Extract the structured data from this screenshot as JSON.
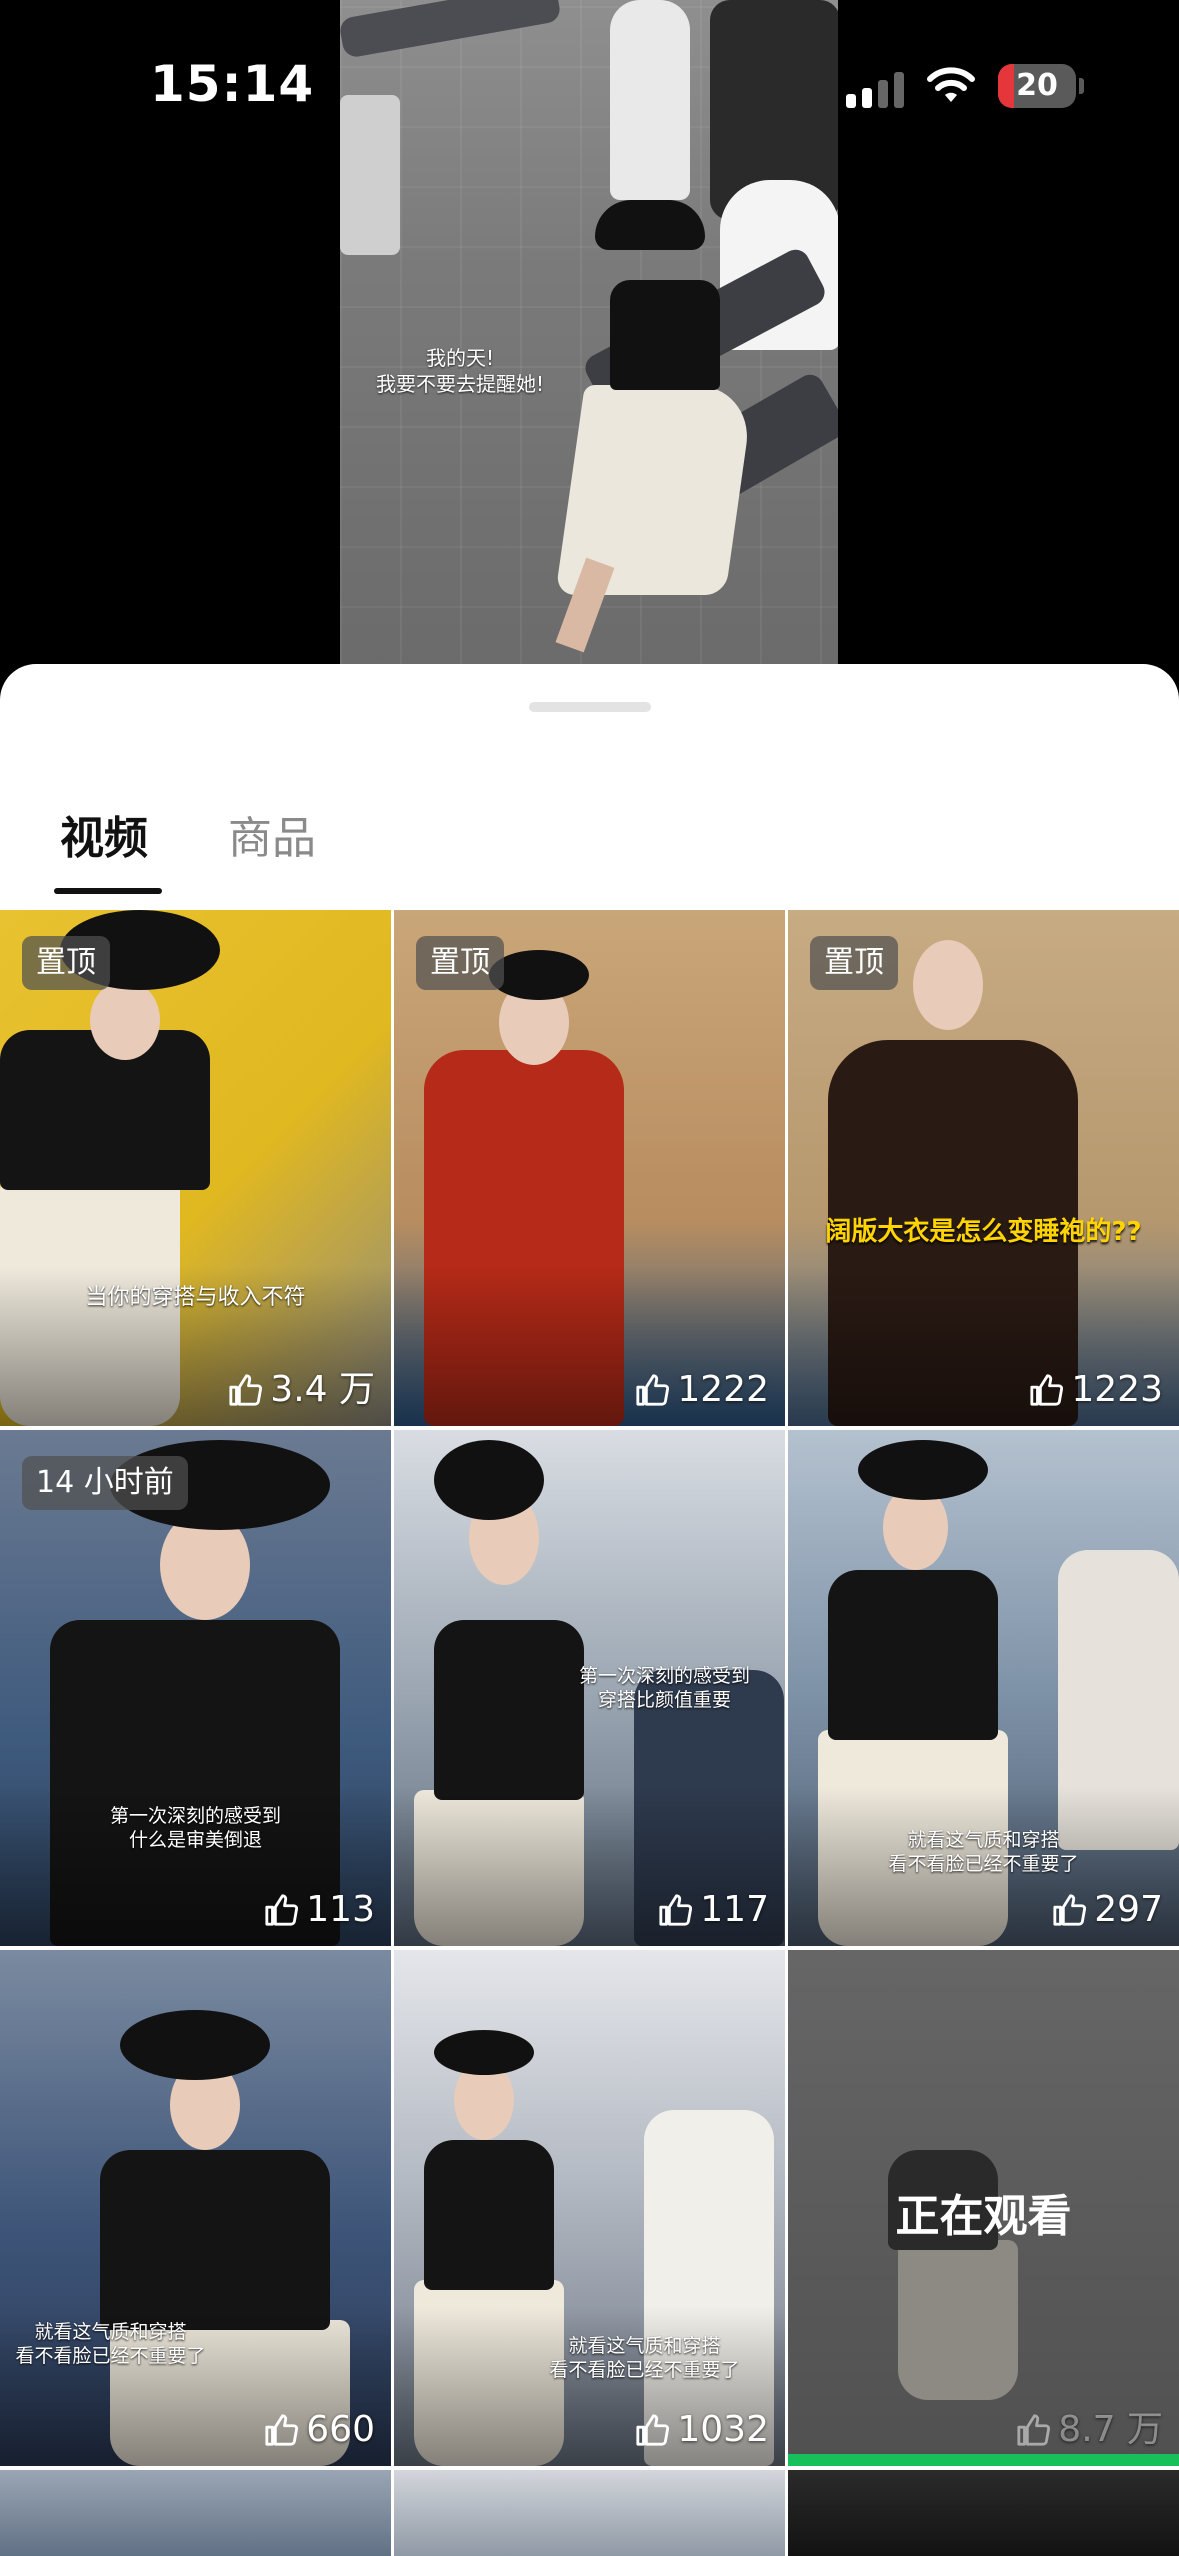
{
  "status_bar": {
    "time": "15:14",
    "battery_level": "20",
    "battery_color": "#e5363c",
    "icons": [
      "signal-icon",
      "wifi-icon",
      "battery-icon"
    ]
  },
  "top_video": {
    "caption_line1": "我的天!",
    "caption_line2": "我要不要去提醒她!"
  },
  "tabs": [
    {
      "label": "视频",
      "active": true
    },
    {
      "label": "商品",
      "active": false
    }
  ],
  "grid": [
    {
      "badge": "置顶",
      "caption": "当你的穿搭与收入不符",
      "likes": "3.4 万"
    },
    {
      "badge": "置顶",
      "caption": "",
      "likes": "1222"
    },
    {
      "badge": "置顶",
      "caption": "阔版大衣是怎么变睡袍的??",
      "likes": "1223"
    },
    {
      "badge": "14 小时前",
      "caption_line1": "第一次深刻的感受到",
      "caption_line2": "什么是审美倒退",
      "likes": "113"
    },
    {
      "badge": "",
      "caption_line1": "第一次深刻的感受到",
      "caption_line2": "穿搭比颜值重要",
      "likes": "117"
    },
    {
      "badge": "",
      "caption_line1": "就看这气质和穿搭",
      "caption_line2": "看不看脸已经不重要了",
      "likes": "297"
    },
    {
      "badge": "",
      "caption_line1": "就看这气质和穿搭",
      "caption_line2": "看不看脸已经不重要了",
      "likes": "660"
    },
    {
      "badge": "",
      "caption_line1": "就看这气质和穿搭",
      "caption_line2": "看不看脸已经不重要了",
      "likes": "1032"
    },
    {
      "badge": "",
      "overlay": "正在观看",
      "likes": "8.7 万",
      "progress": 1.0,
      "progress_color": "#16c15b"
    }
  ]
}
